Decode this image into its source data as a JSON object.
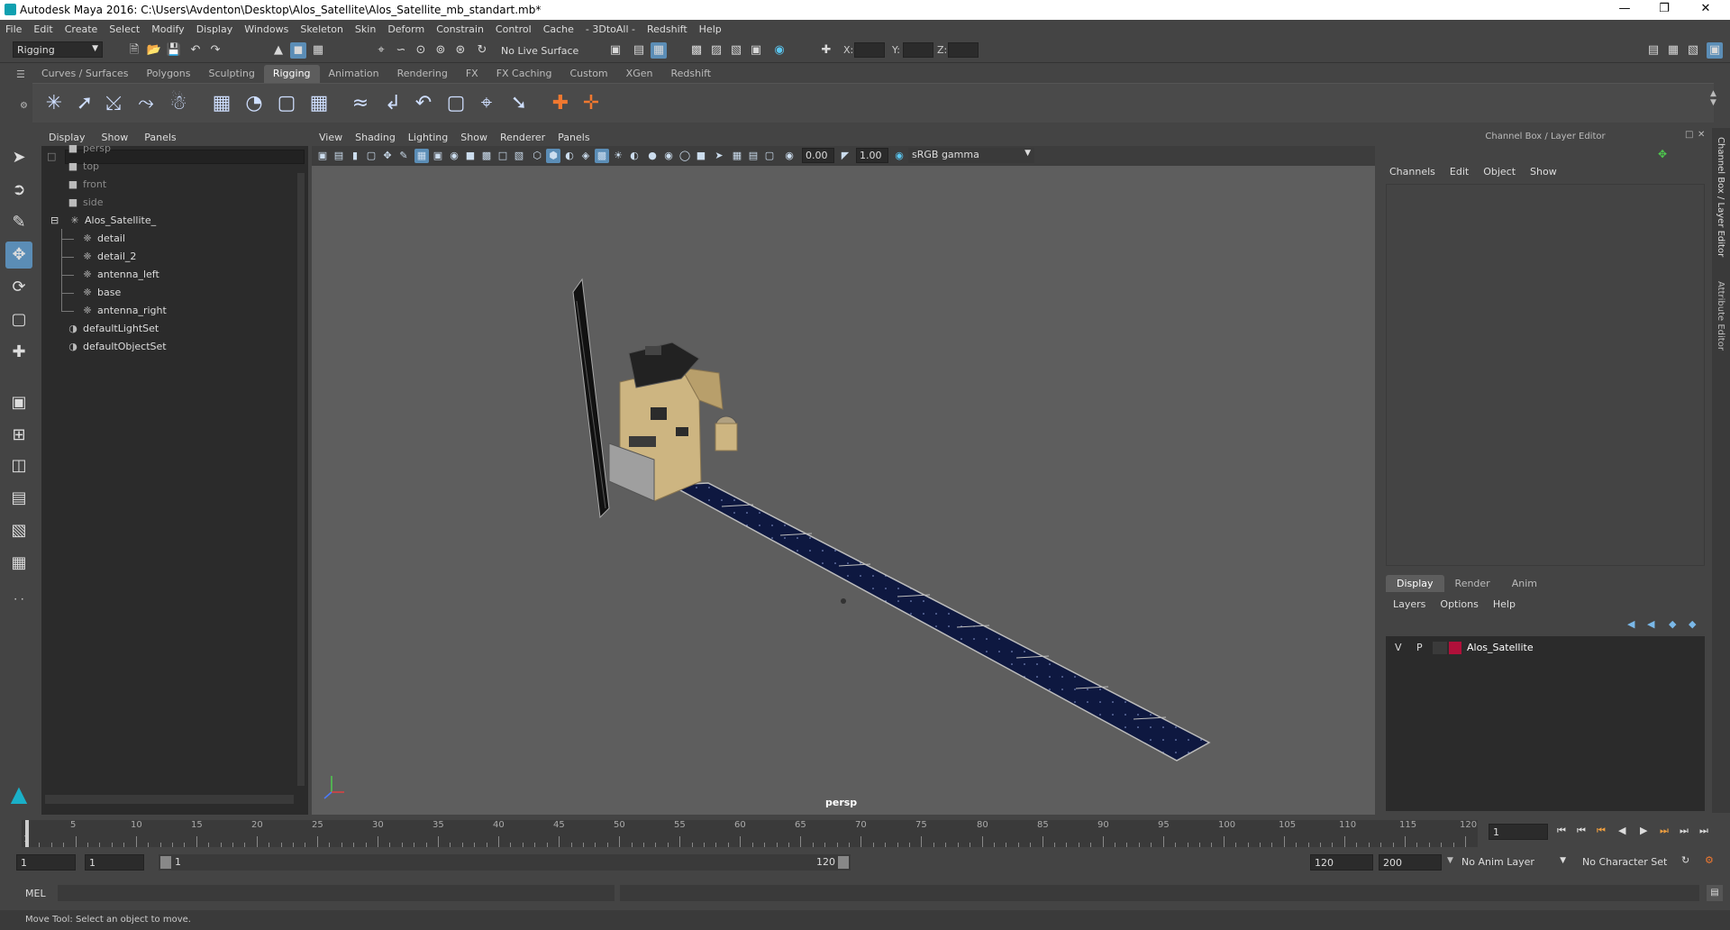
{
  "window": {
    "title": "Autodesk Maya 2016: C:\\Users\\Avdenton\\Desktop\\Alos_Satellite\\Alos_Satellite_mb_standart.mb*"
  },
  "menubar": [
    "File",
    "Edit",
    "Create",
    "Select",
    "Modify",
    "Display",
    "Windows",
    "Skeleton",
    "Skin",
    "Deform",
    "Constrain",
    "Control",
    "Cache",
    "- 3DtoAll -",
    "Redshift",
    "Help"
  ],
  "status_line": {
    "mode": "Rigging",
    "live_surface": "No Live Surface",
    "x_label": "X:",
    "y_label": "Y:",
    "z_label": "Z:"
  },
  "shelf_tabs": [
    "Curves / Surfaces",
    "Polygons",
    "Sculpting",
    "Rigging",
    "Animation",
    "Rendering",
    "FX",
    "FX Caching",
    "Custom",
    "XGen",
    "Redshift"
  ],
  "shelf_active": "Rigging",
  "outliner": {
    "menu": [
      "Display",
      "Show",
      "Panels"
    ],
    "items": [
      {
        "label": "persp",
        "icon": "camera-icon",
        "dim": true
      },
      {
        "label": "top",
        "icon": "camera-icon",
        "dim": true
      },
      {
        "label": "front",
        "icon": "camera-icon",
        "dim": true
      },
      {
        "label": "side",
        "icon": "camera-icon",
        "dim": true
      },
      {
        "label": "Alos_Satellite_",
        "icon": "group-icon",
        "dim": false
      },
      {
        "label": "detail",
        "icon": "mesh-icon",
        "dim": false
      },
      {
        "label": "detail_2",
        "icon": "mesh-icon",
        "dim": false
      },
      {
        "label": "antenna_left",
        "icon": "mesh-icon",
        "dim": false
      },
      {
        "label": "base",
        "icon": "mesh-icon",
        "dim": false
      },
      {
        "label": "antenna_right",
        "icon": "mesh-icon",
        "dim": false
      },
      {
        "label": "defaultLightSet",
        "icon": "set-icon",
        "dim": false
      },
      {
        "label": "defaultObjectSet",
        "icon": "set-icon",
        "dim": false
      }
    ]
  },
  "viewport": {
    "menu": [
      "View",
      "Shading",
      "Lighting",
      "Show",
      "Renderer",
      "Panels"
    ],
    "exposure": "0.00",
    "gamma": "1.00",
    "color_space": "sRGB gamma",
    "camera_label": "persp"
  },
  "channel_box": {
    "title": "Channel Box / Layer Editor",
    "menu": [
      "Channels",
      "Edit",
      "Object",
      "Show"
    ]
  },
  "side_tabs": [
    "Channel Box / Layer Editor",
    "Attribute Editor"
  ],
  "layer_editor": {
    "tabs": [
      "Display",
      "Render",
      "Anim"
    ],
    "menu": [
      "Layers",
      "Options",
      "Help"
    ],
    "layer": {
      "v": "V",
      "p": "P",
      "name": "Alos_Satellite",
      "color": "#b0103a"
    }
  },
  "timeline": {
    "ticks": [
      "1",
      "5",
      "10",
      "15",
      "20",
      "25",
      "30",
      "35",
      "40",
      "45",
      "50",
      "55",
      "60",
      "65",
      "70",
      "75",
      "80",
      "85",
      "90",
      "95",
      "100",
      "105",
      "110",
      "115",
      "120"
    ],
    "current_frame": "1"
  },
  "range": {
    "start": "1",
    "playback_start": "1",
    "slider_start": "1",
    "slider_end": "120",
    "playback_end": "120",
    "end": "200",
    "anim_layer": "No Anim Layer",
    "char_set": "No Character Set"
  },
  "command": {
    "label": "MEL"
  },
  "help_line": "Move Tool: Select an object to move."
}
